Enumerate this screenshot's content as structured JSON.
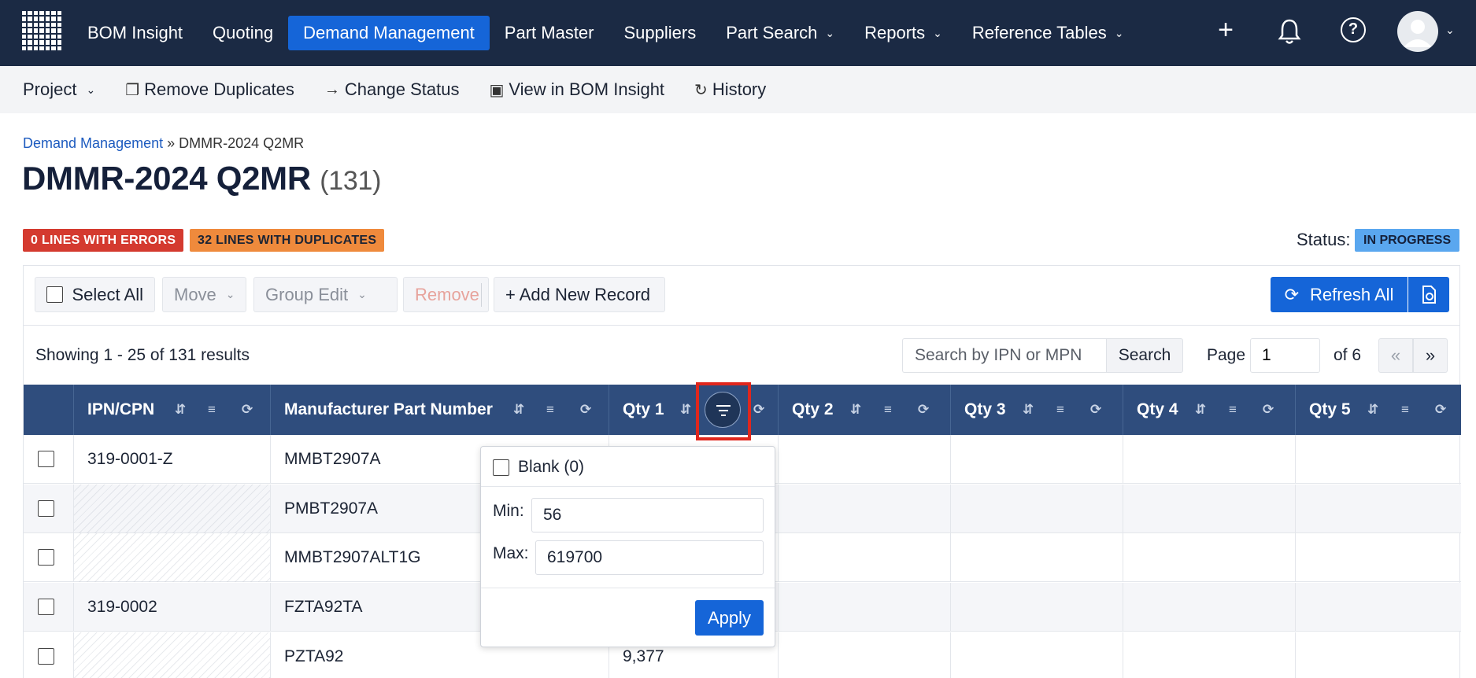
{
  "nav": {
    "items": [
      {
        "label": "BOM Insight",
        "active": false,
        "dropdown": false
      },
      {
        "label": "Quoting",
        "active": false,
        "dropdown": false
      },
      {
        "label": "Demand Management",
        "active": true,
        "dropdown": false
      },
      {
        "label": "Part Master",
        "active": false,
        "dropdown": false
      },
      {
        "label": "Suppliers",
        "active": false,
        "dropdown": false
      },
      {
        "label": "Part Search",
        "active": false,
        "dropdown": true
      },
      {
        "label": "Reports",
        "active": false,
        "dropdown": true
      },
      {
        "label": "Reference Tables",
        "active": false,
        "dropdown": true
      }
    ],
    "plus_icon": "plus-icon",
    "bell_icon": "bell-icon",
    "help_glyph": "?",
    "accent_color": "#1565d8",
    "bg_color": "#1b2a44"
  },
  "subbar": {
    "project": "Project",
    "remove_duplicates": "Remove Duplicates",
    "change_status": "Change Status",
    "view_bom": "View in BOM Insight",
    "history": "History"
  },
  "breadcrumb": {
    "parent": "Demand Management",
    "sep": "»",
    "current": "DMMR-2024 Q2MR"
  },
  "title": {
    "name": "DMMR-2024 Q2MR",
    "count": "(131)"
  },
  "badges": {
    "errors": "0 LINES WITH ERRORS",
    "duplicates": "32 LINES WITH DUPLICATES"
  },
  "status": {
    "label": "Status:",
    "value": "IN PROGRESS"
  },
  "toolbar": {
    "select_all": "Select All",
    "move": "Move",
    "group_edit": "Group Edit",
    "remove": "Remove",
    "add_new": "+ Add New Record",
    "refresh_all": "Refresh All"
  },
  "results": {
    "showing": "Showing 1 - 25 of 131 results",
    "search_placeholder": "Search by IPN or MPN",
    "search_button": "Search",
    "page_label": "Page",
    "page_value": "1",
    "of_label": "of 6",
    "prev": "«",
    "next": "»"
  },
  "table": {
    "columns": [
      "IPN/CPN",
      "Manufacturer Part Number",
      "Qty 1",
      "Qty 2",
      "Qty 3",
      "Qty 4",
      "Qty 5"
    ],
    "rows": [
      {
        "ipn": "319-0001-Z",
        "mpn": "MMBT2907A",
        "qty1": "",
        "alt": false,
        "hatch": false
      },
      {
        "ipn": "",
        "mpn": "PMBT2907A",
        "qty1": "",
        "alt": true,
        "hatch": true
      },
      {
        "ipn": "",
        "mpn": "MMBT2907ALT1G",
        "qty1": "",
        "alt": false,
        "hatch": true
      },
      {
        "ipn": "319-0002",
        "mpn": "FZTA92TA",
        "qty1": "",
        "alt": true,
        "hatch": false
      },
      {
        "ipn": "",
        "mpn": "PZTA92",
        "qty1": "9,377",
        "alt": false,
        "hatch": true
      }
    ]
  },
  "filter_popover": {
    "blank_label": "Blank (0)",
    "min_label": "Min:",
    "min_value": "56",
    "max_label": "Max:",
    "max_value": "619700",
    "apply": "Apply"
  }
}
